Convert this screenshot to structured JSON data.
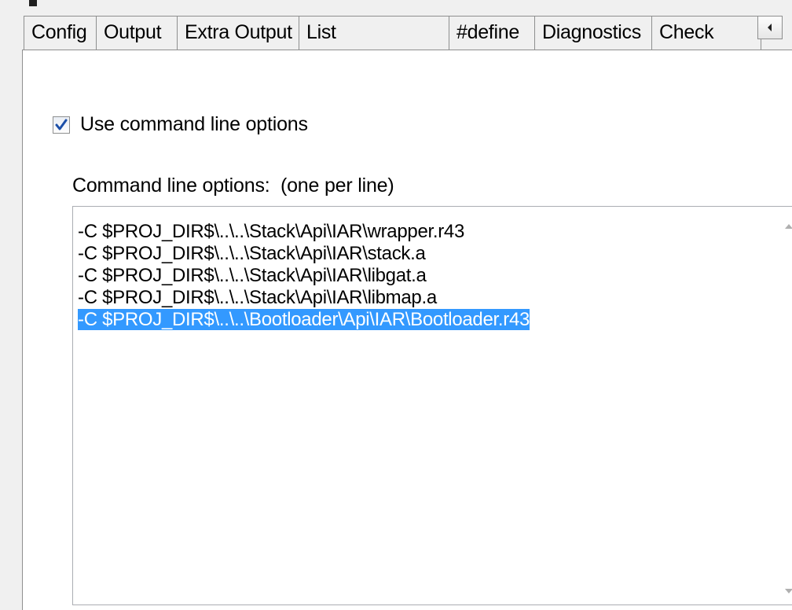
{
  "tabs": [
    {
      "label": "Config",
      "selected": false
    },
    {
      "label": "Output",
      "selected": false
    },
    {
      "label": "Extra Output",
      "selected": false
    },
    {
      "label": "List",
      "selected": false
    },
    {
      "label": "#define",
      "selected": false
    },
    {
      "label": "Diagnostics",
      "selected": false
    },
    {
      "label": "Check",
      "selected": false
    }
  ],
  "tab_scroll_icon": "chevron-left-icon",
  "options": {
    "use_cmd_line_label": "Use command line options",
    "use_cmd_line_checked": true,
    "cmd_label": "Command line options:  (one per line)",
    "lines": [
      "-C $PROJ_DIR$\\..\\..\\Stack\\Api\\IAR\\wrapper.r43",
      "-C $PROJ_DIR$\\..\\..\\Stack\\Api\\IAR\\stack.a",
      "-C $PROJ_DIR$\\..\\..\\Stack\\Api\\IAR\\libgat.a",
      "-C $PROJ_DIR$\\..\\..\\Stack\\Api\\IAR\\libmap.a",
      "-C $PROJ_DIR$\\..\\..\\Bootloader\\Api\\IAR\\Bootloader.r43"
    ],
    "selected_line_index": 4
  },
  "colors": {
    "selection": "#3399ff",
    "border": "#8e8f8f",
    "background": "#f0f0f0"
  }
}
